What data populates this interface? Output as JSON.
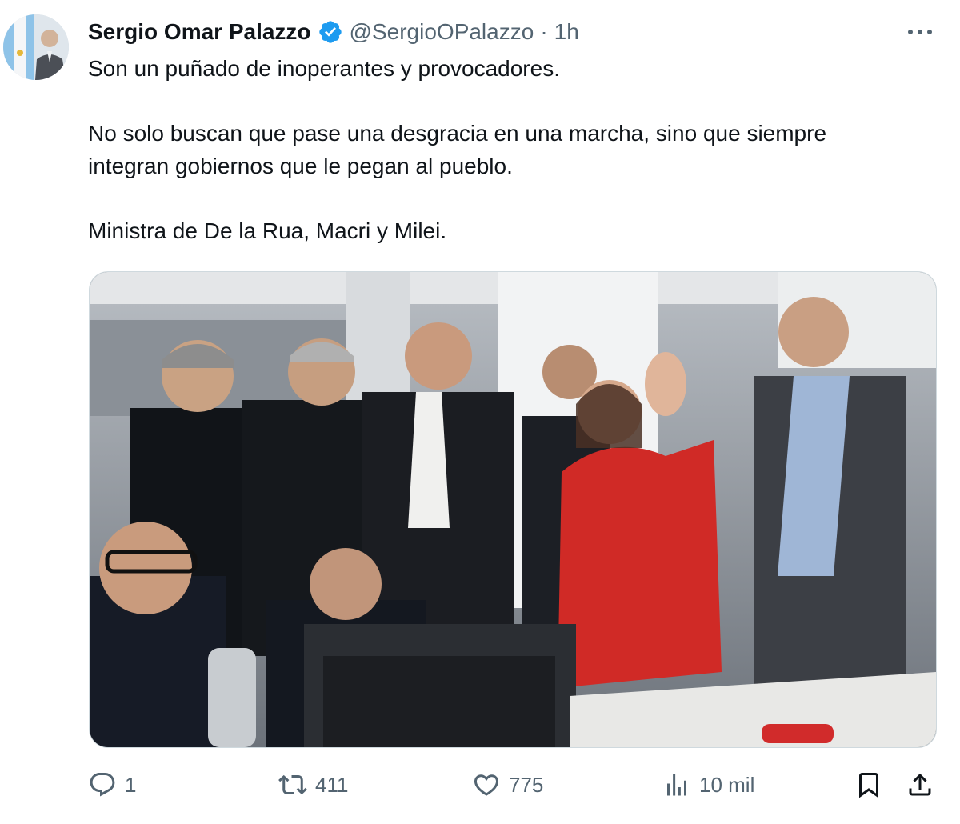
{
  "author": {
    "name": "Sergio Omar Palazzo",
    "handle": "@SergioOPalazzo",
    "separator": "·",
    "time": "1h"
  },
  "tweet": {
    "lines": [
      "Son un puñado de inoperantes y provocadores.",
      "No solo buscan que pase una desgracia en una marcha, sino que siempre",
      "integran gobiernos que le pegan al pueblo.",
      "Ministra de De la Rua, Macri y Milei."
    ]
  },
  "actions": {
    "replies": "1",
    "reposts": "411",
    "likes": "775",
    "views": "10 mil"
  },
  "icons": {
    "verified": "verified-badge-icon",
    "more": "more-icon",
    "reply": "reply-icon",
    "repost": "repost-icon",
    "like": "heart-icon",
    "views": "views-icon",
    "bookmark": "bookmark-icon",
    "share": "share-icon"
  },
  "colors": {
    "text": "#0f1419",
    "secondary": "#536471",
    "verified": "#1d9bf0"
  }
}
